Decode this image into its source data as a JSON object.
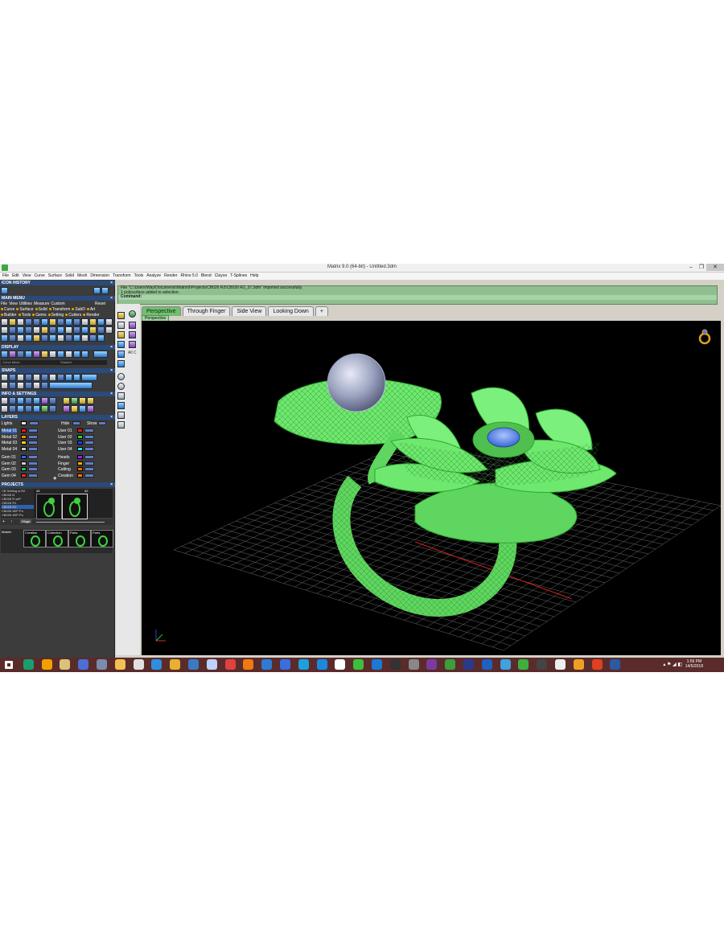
{
  "window": {
    "title": "Matrix 9.0 (64-bit) - Untitled.3dm",
    "min": "–",
    "max": "❐",
    "close": "✕"
  },
  "menu": [
    "File",
    "Edit",
    "View",
    "Curve",
    "Surface",
    "Solid",
    "Mesh",
    "Dimension",
    "Transform",
    "Tools",
    "Analyze",
    "Render",
    "Rhino 5.0",
    "Blend",
    "Clayoo",
    "T-Splines",
    "Help"
  ],
  "left": {
    "icon_history": "ICON HISTORY",
    "main_menu": "MAIN MENU",
    "main_menu_items": [
      "File",
      "View",
      "Utilities",
      "Measure",
      "Custom"
    ],
    "reset": "Reset",
    "cats_row1": [
      {
        "label": "Curve",
        "color": "#f2a000"
      },
      {
        "label": "Surface",
        "color": "#f2a000"
      },
      {
        "label": "Solid",
        "color": "#f2a000"
      },
      {
        "label": "Transform",
        "color": "#f2a000"
      },
      {
        "label": "SubD",
        "color": "#f2a000"
      },
      {
        "label": "Art",
        "color": "#f2a000"
      }
    ],
    "cats_row2": [
      {
        "label": "Builder",
        "color": "#f2a000"
      },
      {
        "label": "Tools",
        "color": "#f2a000"
      },
      {
        "label": "Gems",
        "color": "#f2a000"
      },
      {
        "label": "Setting",
        "color": "#f2a000"
      },
      {
        "label": "Cutters",
        "color": "#f2a000"
      },
      {
        "label": "Render",
        "color": "#f2a000"
      }
    ],
    "display": "DISPLAY",
    "display_mode_a": "Curve Mesh",
    "display_mode_b": "Shaded",
    "snaps": "SNAPS",
    "info_settings": "INFO & SETTINGS",
    "layers": "LAYERS",
    "lights": "Lights",
    "hide": "Hide",
    "show": "Show",
    "layers_left": [
      {
        "name": "Metal 01",
        "color": "#ff1a1a"
      },
      {
        "name": "Metal 02",
        "color": "#ff8c1a"
      },
      {
        "name": "Metal 03",
        "color": "#ffd21a"
      },
      {
        "name": "Metal 04",
        "color": "#c8c8c8"
      },
      {
        "name": "Gem 01",
        "color": "#2a6fff"
      },
      {
        "name": "Gem 02",
        "color": "#cfcfcf"
      },
      {
        "name": "Gem 03",
        "color": "#1fbf5a"
      },
      {
        "name": "Gem 04",
        "color": "#ff2a2a"
      }
    ],
    "layers_right": [
      {
        "name": "User 01",
        "color": "#ff1a1a"
      },
      {
        "name": "User 02",
        "color": "#1fdf1f"
      },
      {
        "name": "User 03",
        "color": "#2a3cff"
      },
      {
        "name": "User 04",
        "color": "#2adfff"
      },
      {
        "name": "Heads",
        "color": "#a020f0"
      },
      {
        "name": "Finger",
        "color": "#ffb000"
      },
      {
        "name": "Cutting",
        "color": "#ff6a00"
      },
      {
        "name": "Creation",
        "color": "#ff7a00"
      }
    ],
    "projects": "PROJECTS",
    "project_list": [
      "CB Setting w R2",
      "CB026 N",
      "CB026 R wIP",
      "CB026 R1",
      "CB026 R2",
      "CB026 WIP Pu",
      "CB026 WIP Pu"
    ],
    "thumb_a": "45",
    "thumb_b": "42",
    "hinge": "Hinge",
    "master": "Master",
    "master_tabs": [
      "Creation",
      "Collection",
      "Parts",
      "Parts"
    ]
  },
  "command": {
    "line1": "File \"C:\\Users\\Way\\Documents\\Matrix9\\Projects\\CB026 R2\\CB026 R2_37.3dm\" imported successfully.",
    "line2": "1 polysurface added to selection.",
    "prompt": "Command:"
  },
  "viewport": {
    "tabs": [
      "Perspective",
      "Through Finger",
      "Side View",
      "Looking Down"
    ],
    "add": "+",
    "label": "Perspective",
    "allc": "All C"
  },
  "taskbar": {
    "time": "1:59 PM",
    "date": "14/5/2018"
  }
}
